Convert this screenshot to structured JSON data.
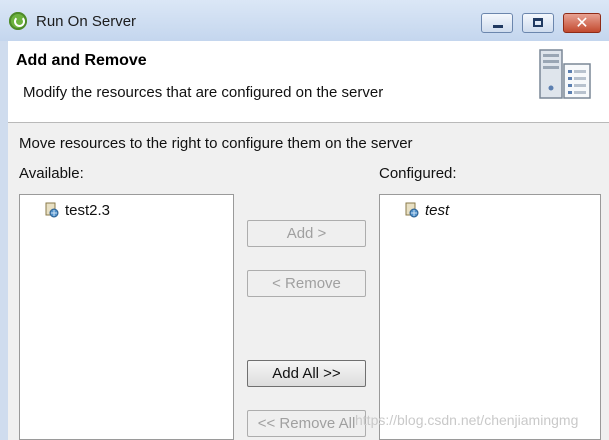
{
  "window": {
    "title": "Run On Server",
    "icon": "spring-leaf-icon",
    "controls": {
      "minimize": "minimize-icon",
      "maximize": "maximize-icon",
      "close_label": "✕"
    }
  },
  "header": {
    "title": "Add and Remove",
    "description": "Modify the resources that are configured on the server",
    "icon": "server-icon"
  },
  "body": {
    "instruction": "Move resources to the right to configure them on the server",
    "available_label": "Available:",
    "configured_label": "Configured:",
    "available_items": [
      {
        "label": "test2.3",
        "icon": "web-project-icon"
      }
    ],
    "configured_items": [
      {
        "label": "test",
        "icon": "web-project-icon"
      }
    ]
  },
  "buttons": {
    "add": "Add >",
    "remove": "< Remove",
    "add_all": "Add All >>",
    "remove_all": "<< Remove All"
  },
  "watermark": "https://blog.csdn.net/chenjiamingmg"
}
